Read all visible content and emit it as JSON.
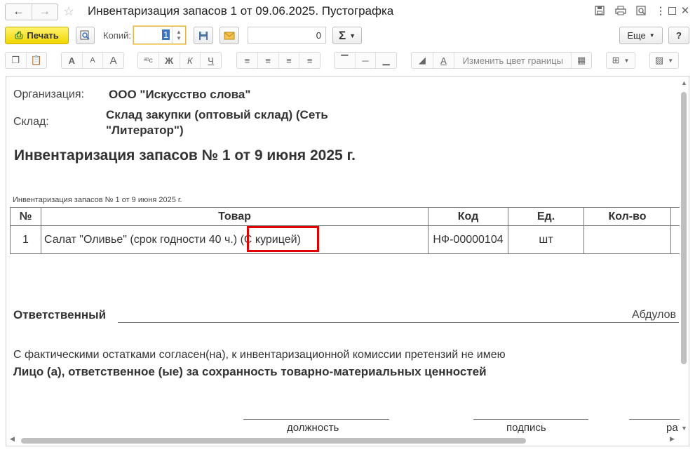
{
  "window": {
    "title": "Инвентаризация запасов 1 от 09.06.2025. Пустографка"
  },
  "titlebar_icons": [
    "save-icon",
    "printer-icon",
    "search-doc-icon",
    "more-vertical-icon",
    "minimize-icon",
    "maximize-icon",
    "close-icon"
  ],
  "toolbar": {
    "print_label": "Печать",
    "copies_label": "Копий:",
    "copies_value": "1",
    "sum_value": "0",
    "sigma_label": "Σ",
    "more_label": "Еще",
    "help_label": "?"
  },
  "format_toolbar": {
    "font_grow": "A",
    "font_small": "A",
    "font_big": "A",
    "spell": "ᵃᵇc",
    "bold": "Ж",
    "italic": "К",
    "underline": "Ч",
    "border_color_label": "Изменить цвет границы"
  },
  "document": {
    "org_label": "Организация:",
    "org_value": "ООО \"Искусство слова\"",
    "warehouse_label": "Склад:",
    "warehouse_value_line1": "Склад закупки (оптовый склад) (Сеть",
    "warehouse_value_line2": "\"Литератор\")",
    "heading": "Инвентаризация запасов № 1 от 9 июня 2025 г.",
    "small_caption": "Инвентаризация запасов № 1 от 9 июня 2025 г.",
    "table": {
      "columns": [
        "№",
        "Товар",
        "Код",
        "Ед.",
        "Кол-во"
      ],
      "rows": [
        {
          "num": "1",
          "product_main": "Салат \"Оливье\" (срок годности 40 ч.)",
          "product_highlight": "(С курицей)",
          "code": "НФ-00000104",
          "unit": "шт",
          "qty": ""
        }
      ]
    },
    "responsible_label": "Ответственный",
    "responsible_value": "Абдулов",
    "agreement_text": "С фактическими остатками согласен(на), к инвентаризационной комиссии претензий не имею",
    "liable_heading": "Лицо (а), ответственное (ые) за сохранность товарно-материальных ценностей",
    "sig_position": "должность",
    "sig_signature": "подпись",
    "sig_third": "ра"
  },
  "colors": {
    "print_button": "#f1d600",
    "highlight_box": "#e00000"
  }
}
